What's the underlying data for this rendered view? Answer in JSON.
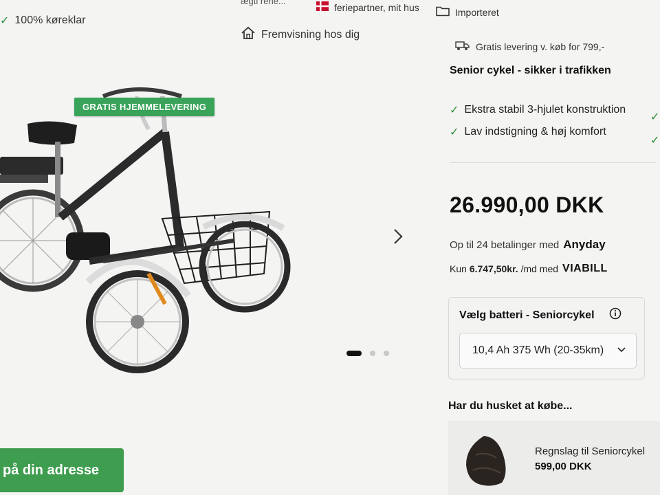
{
  "topbar": {
    "fragment": "ægti   rene...",
    "partner_label": "feriepartner, mit hus",
    "imported_label": "Importeret",
    "ready_label": "100% køreklar",
    "showing_label": "Fremvisning hos dig"
  },
  "product": {
    "badge": "GRATIS HJEMMELEVERING",
    "shipping": "Gratis levering v. køb for 799,-",
    "title": "Senior cykel - sikker i trafikken",
    "features": [
      "Ekstra stabil 3-hjulet konstruktion",
      "Lav indstigning & høj komfort"
    ],
    "price": "26.990,00 DKK"
  },
  "payment": {
    "anyday_text": "Op til 24 betalinger med",
    "anyday_brand": "Anyday",
    "viabill_prefix": "Kun",
    "viabill_amount": "6.747,50kr.",
    "viabill_suffix": "/md med",
    "viabill_brand": "VIABILL"
  },
  "battery": {
    "label": "Vælg batteri - Seniorcykel",
    "selected": "10,4 Ah 375 Wh (20-35km)"
  },
  "accessories": {
    "heading": "Har du husket at købe...",
    "items": [
      {
        "name": "Regnslag til Seniorcykel",
        "price": "599,00 DKK"
      }
    ]
  },
  "cta": {
    "label": "på din adresse"
  },
  "carousel": {
    "total": 3,
    "active": 1
  },
  "colors": {
    "accent_green": "#3aa35a",
    "check_green": "#2a8a3a"
  },
  "icons": [
    "house-icon",
    "flag-icon",
    "folder-icon",
    "truck-icon",
    "check-icon",
    "info-icon",
    "chevron-right-icon",
    "chevron-down-icon"
  ]
}
